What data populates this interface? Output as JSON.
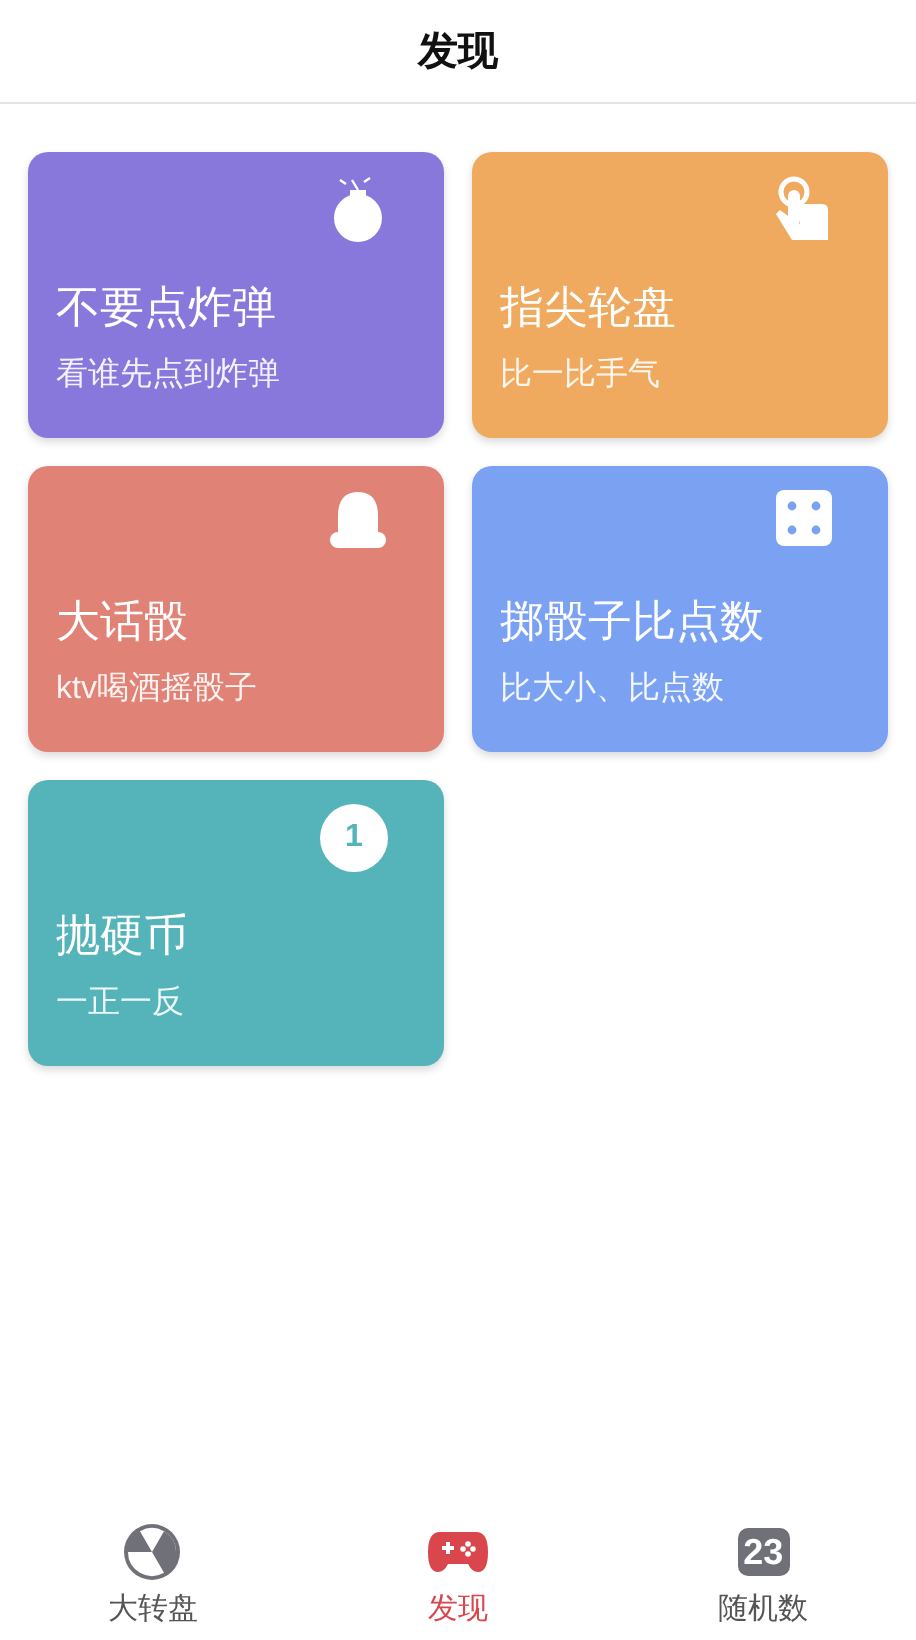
{
  "header": {
    "title": "发现"
  },
  "cards": [
    {
      "title": "不要点炸弹",
      "subtitle": "看谁先点到炸弹",
      "color": "#8878dc",
      "kind": "bomb"
    },
    {
      "title": "指尖轮盘",
      "subtitle": "比一比手气",
      "color": "#efaa60",
      "kind": "finger"
    },
    {
      "title": "大话骰",
      "subtitle": "ktv喝酒摇骰子",
      "color": "#e08276",
      "kind": "cup"
    },
    {
      "title": "掷骰子比点数",
      "subtitle": "比大小、比点数",
      "color": "#7aa1f2",
      "kind": "dice"
    },
    {
      "title": "抛硬币",
      "subtitle": "一正一反",
      "color": "#55b4b9",
      "kind": "coin",
      "badge": "1"
    }
  ],
  "tabs": [
    {
      "label": "大转盘",
      "selected": false,
      "kind": "wheel"
    },
    {
      "label": "发现",
      "selected": true,
      "kind": "gamepad"
    },
    {
      "label": "随机数",
      "selected": false,
      "kind": "number",
      "badge": "23"
    }
  ]
}
